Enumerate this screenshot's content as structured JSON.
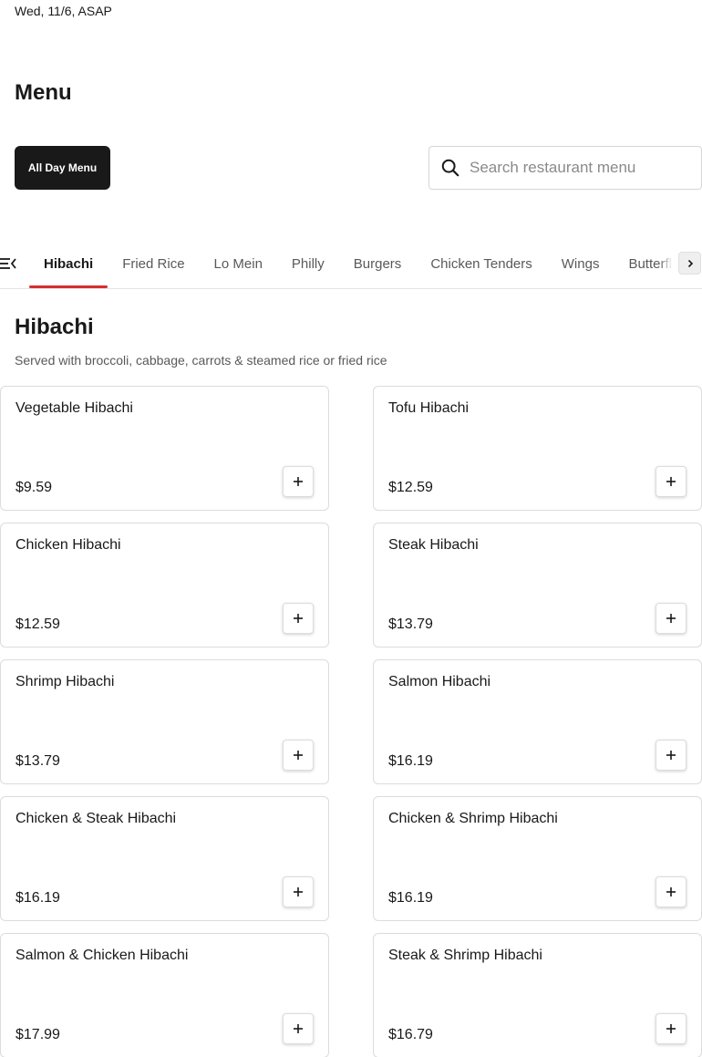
{
  "schedule": "Wed, 11/6, ASAP",
  "menu": {
    "title": "Menu",
    "selector_label": "All Day Menu"
  },
  "search": {
    "placeholder": "Search restaurant menu",
    "value": ""
  },
  "tabs": [
    {
      "label": "Hibachi",
      "active": true
    },
    {
      "label": "Fried Rice"
    },
    {
      "label": "Lo Mein"
    },
    {
      "label": "Philly"
    },
    {
      "label": "Burgers"
    },
    {
      "label": "Chicken Tenders"
    },
    {
      "label": "Wings"
    },
    {
      "label": "Butterfl"
    }
  ],
  "section": {
    "title": "Hibachi",
    "description": "Served with broccoli, cabbage, carrots & steamed rice or fried rice",
    "items": [
      {
        "name": "Vegetable Hibachi",
        "price": "$9.59"
      },
      {
        "name": "Tofu Hibachi",
        "price": "$12.59"
      },
      {
        "name": "Chicken Hibachi",
        "price": "$12.59"
      },
      {
        "name": "Steak Hibachi",
        "price": "$13.79"
      },
      {
        "name": "Shrimp Hibachi",
        "price": "$13.79"
      },
      {
        "name": "Salmon Hibachi",
        "price": "$16.19"
      },
      {
        "name": "Chicken & Steak Hibachi",
        "price": "$16.19"
      },
      {
        "name": "Chicken & Shrimp Hibachi",
        "price": "$16.19"
      },
      {
        "name": "Salmon & Chicken Hibachi",
        "price": "$17.99"
      },
      {
        "name": "Steak & Shrimp Hibachi",
        "price": "$16.79"
      }
    ]
  },
  "icons": {
    "search": "search-icon",
    "tab_menu": "menu-list-icon",
    "tab_next": "chevron-right-icon",
    "add": "plus-icon"
  },
  "colors": {
    "accent": "#d32f2f",
    "primary_button": "#191919"
  }
}
